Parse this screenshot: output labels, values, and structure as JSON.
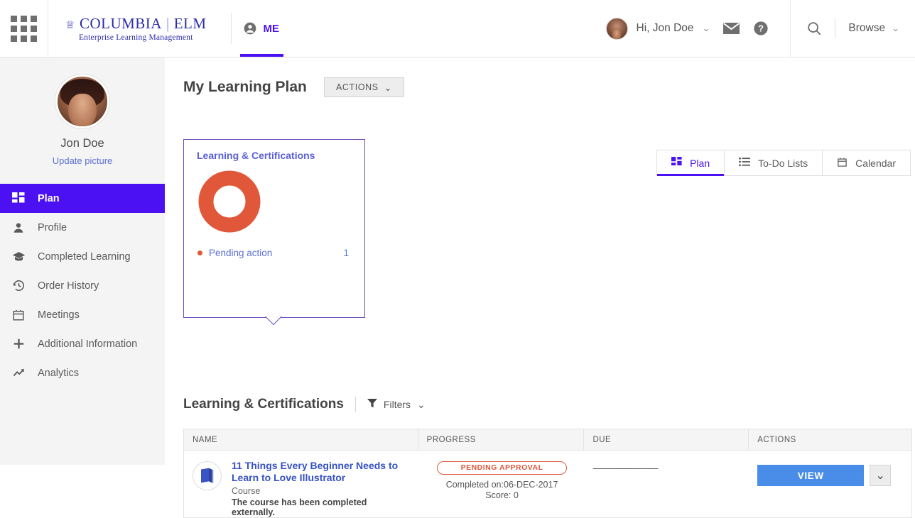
{
  "header": {
    "apps_icon": "apps-grid-icon",
    "brand": {
      "crown": "♕",
      "name_primary": "COLUMBIA",
      "divider": "|",
      "name_secondary": "ELM",
      "tagline": "Enterprise Learning Management"
    },
    "me_tab": {
      "label": "ME",
      "icon": "person-icon"
    },
    "user": {
      "greeting": "Hi, Jon Doe",
      "chevron": "⌄",
      "avatar": "user-avatar"
    },
    "mail_icon": "mail-icon",
    "help_icon": "help-icon",
    "search_icon": "search-icon",
    "browse": {
      "label": "Browse",
      "chevron": "⌄"
    }
  },
  "sidebar": {
    "user_name": "Jon Doe",
    "update_picture": "Update picture",
    "items": [
      {
        "label": "Plan",
        "icon": "dashboard-grid-icon",
        "active": true
      },
      {
        "label": "Profile",
        "icon": "person-icon",
        "active": false
      },
      {
        "label": "Completed Learning",
        "icon": "graduation-cap-icon",
        "active": false
      },
      {
        "label": "Order History",
        "icon": "history-clock-icon",
        "active": false
      },
      {
        "label": "Meetings",
        "icon": "calendar-icon",
        "active": false
      },
      {
        "label": "Additional Information",
        "icon": "plus-icon",
        "active": false
      },
      {
        "label": "Analytics",
        "icon": "trend-up-icon",
        "active": false
      }
    ]
  },
  "main": {
    "page_title": "My Learning Plan",
    "actions_button": {
      "label": "ACTIONS",
      "chevron": "⌄"
    },
    "tabs": [
      {
        "label": "Plan",
        "icon": "dashboard-grid-icon",
        "active": true
      },
      {
        "label": "To-Do Lists",
        "icon": "list-icon",
        "active": false
      },
      {
        "label": "Calendar",
        "icon": "calendar-icon",
        "active": false
      }
    ],
    "card": {
      "title": "Learning & Certifications",
      "legend_label": "Pending action",
      "legend_count": "1"
    },
    "list_section": {
      "title": "Learning & Certifications",
      "filters_label": "Filters",
      "filters_icon": "funnel-icon",
      "filters_chevron": "⌄"
    },
    "table": {
      "columns": [
        "NAME",
        "PROGRESS",
        "DUE",
        "ACTIONS"
      ],
      "rows": [
        {
          "icon": "book-icon",
          "name": "11 Things Every Beginner Needs to Learn to Love Illustrator",
          "type": "Course",
          "note": "The course has been completed externally.",
          "status_badge": "PENDING APPROVAL",
          "completed_on": "Completed on:06-DEC-2017",
          "score": "Score: 0",
          "due": "———————",
          "action_label": "VIEW",
          "action_chevron": "⌄"
        }
      ]
    }
  },
  "chart_data": {
    "type": "pie",
    "title": "Learning & Certifications",
    "categories": [
      "Pending action"
    ],
    "values": [
      1
    ],
    "colors": [
      "#e0573a"
    ],
    "total": 1,
    "legend_position": "bottom",
    "donut": true
  },
  "colors": {
    "accent_purple": "#4b11f2",
    "brand_blue": "#2c2ca8",
    "orange": "#e0573a",
    "link_blue": "#3652c4",
    "button_blue": "#4a8de8",
    "card_border": "#6b4bbd"
  }
}
